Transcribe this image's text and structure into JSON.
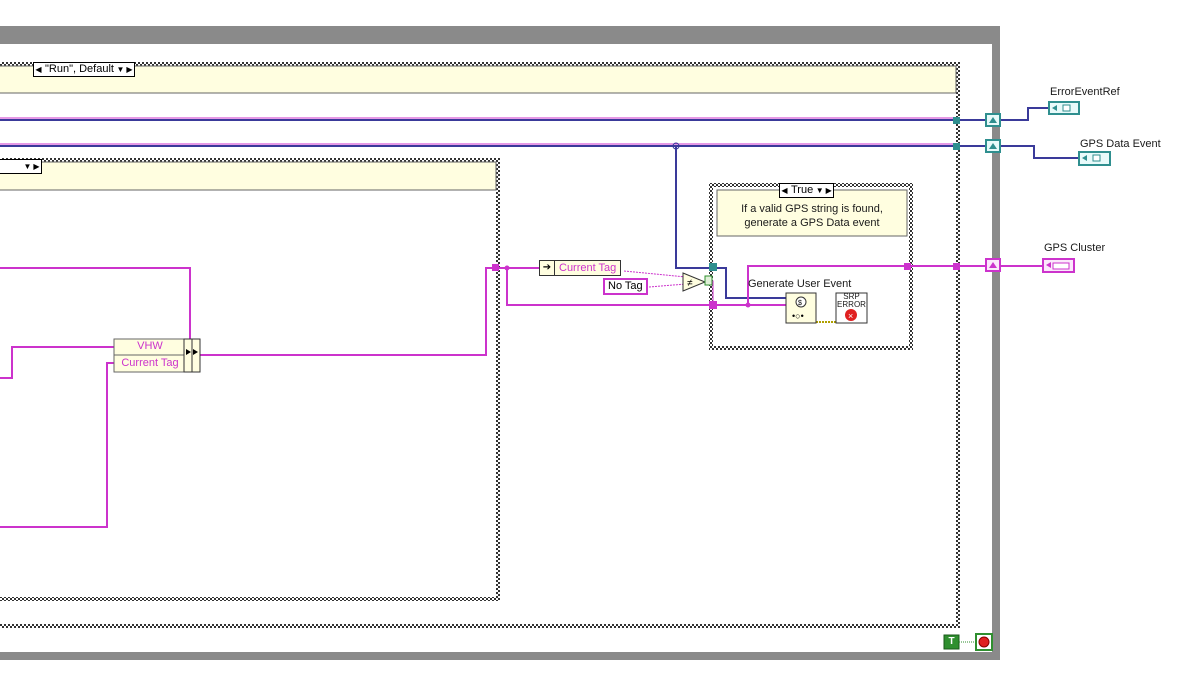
{
  "outer_case": {
    "selector_label": "\"Run\", Default"
  },
  "inner_case": {
    "selector_label": ""
  },
  "true_case": {
    "selector_label": "True",
    "comment_line1": "If a valid GPS string is found,",
    "comment_line2": "generate a GPS Data event"
  },
  "unbundle": {
    "field1": "VHW",
    "field2": "Current Tag"
  },
  "local_variable": {
    "label": "Current Tag"
  },
  "constant": {
    "value": "No Tag"
  },
  "generate_event": {
    "label": "Generate User Event"
  },
  "error_node": {
    "line1": "SRP",
    "line2": "ERROR"
  },
  "indicators": [
    {
      "label": "ErrorEventRef"
    },
    {
      "label": "GPS Data Event"
    },
    {
      "label": "GPS Cluster"
    }
  ],
  "loop_condition": {
    "t_label": "T"
  },
  "colors": {
    "wire_pink": "#cc33cc",
    "wire_blue": "#3a3a9a",
    "case_fill": "#fffee0",
    "teal": "#2f8f8f"
  }
}
